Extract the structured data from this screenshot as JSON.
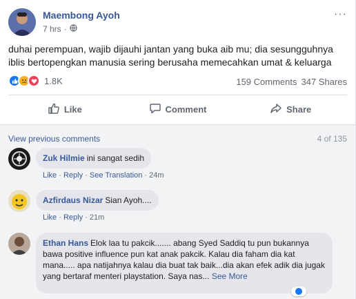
{
  "post": {
    "author": "Maembong Ayoh",
    "time": "7 hrs",
    "dot": "·",
    "text": "duhai perempuan, wajib dijauhi jantan yang buka aib mu; dia sesungguhnya iblis bertopengkan manusia sering berusaha memecahkan umat & keluarga",
    "more": "···",
    "reaction_count": "1.8K",
    "comments_count": "159 Comments",
    "shares_count": "347 Shares"
  },
  "actions": {
    "like": "Like",
    "comment": "Comment",
    "share": "Share"
  },
  "comments_section": {
    "view_previous": "View previous comments",
    "pager": "4 of 135",
    "items": [
      {
        "name": "Zuk Hilmie",
        "text": "ini sangat sedih",
        "like": "Like",
        "reply": "Reply",
        "translation": "See Translation",
        "time": "24m",
        "sep": "·"
      },
      {
        "name": "Azfirdaus Nizar",
        "text": "Sian Ayoh....",
        "like": "Like",
        "reply": "Reply",
        "time": "21m",
        "sep": "·"
      },
      {
        "name": "Ethan Hans",
        "text": "Elok laa tu pakcik....... abang Syed Saddiq tu pun bukannya bawa positive influence pun kat anak pakcik. Kalau dia faham dia kat mana..... apa natijahnya kalau dia buat tak baik...dia akan efek adik dia jugak yang bertaraf menteri playstation. Saya nas...",
        "see_more": "See More"
      }
    ]
  },
  "colors": {
    "link": "#385898",
    "meta": "#606770",
    "bubble": "#e4e6eb",
    "comments_bg": "#f2f3f5",
    "like_blue": "#1877f2",
    "love_red": "#f33e58",
    "sad_yellow": "#f7b125"
  },
  "icons": [
    "like-reaction-icon",
    "sad-reaction-icon",
    "love-reaction-icon",
    "globe-icon",
    "more-icon",
    "thumbs-up-icon",
    "comment-icon",
    "share-icon"
  ]
}
